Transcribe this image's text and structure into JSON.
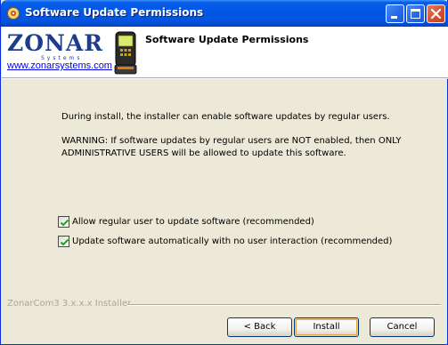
{
  "window": {
    "title": "Software Update Permissions"
  },
  "header": {
    "logo_text": "ZONAR",
    "logo_sub": "Systems",
    "logo_url": "www.zonarsystems.com",
    "title": "Software Update Permissions"
  },
  "content": {
    "intro": "During install, the installer can enable software updates by regular users.",
    "warning": "WARNING:  If software updates by regular users are NOT enabled, then ONLY ADMINISTRATIVE USERS will be allowed to update this software.",
    "options": [
      {
        "label": "Allow regular user to update software (recommended)",
        "checked": true
      },
      {
        "label": "Update software automatically with no user interaction (recommended)",
        "checked": true
      }
    ]
  },
  "footer": {
    "brand": "ZonarCom3 3.x.x.x Installer",
    "back_label": "< Back",
    "install_label": "Install",
    "cancel_label": "Cancel"
  },
  "icons": {
    "app": "installer-icon",
    "minimize": "minimize-icon",
    "maximize": "maximize-icon",
    "close": "close-icon",
    "check": "check-icon",
    "device": "handheld-device-icon"
  },
  "colors": {
    "titlebar": "#0058e6",
    "dialog_bg": "#ece9d8",
    "close_button": "#d0502e",
    "logo": "#1c3c8c",
    "link": "#0000ee",
    "brand_text": "#aca899"
  }
}
